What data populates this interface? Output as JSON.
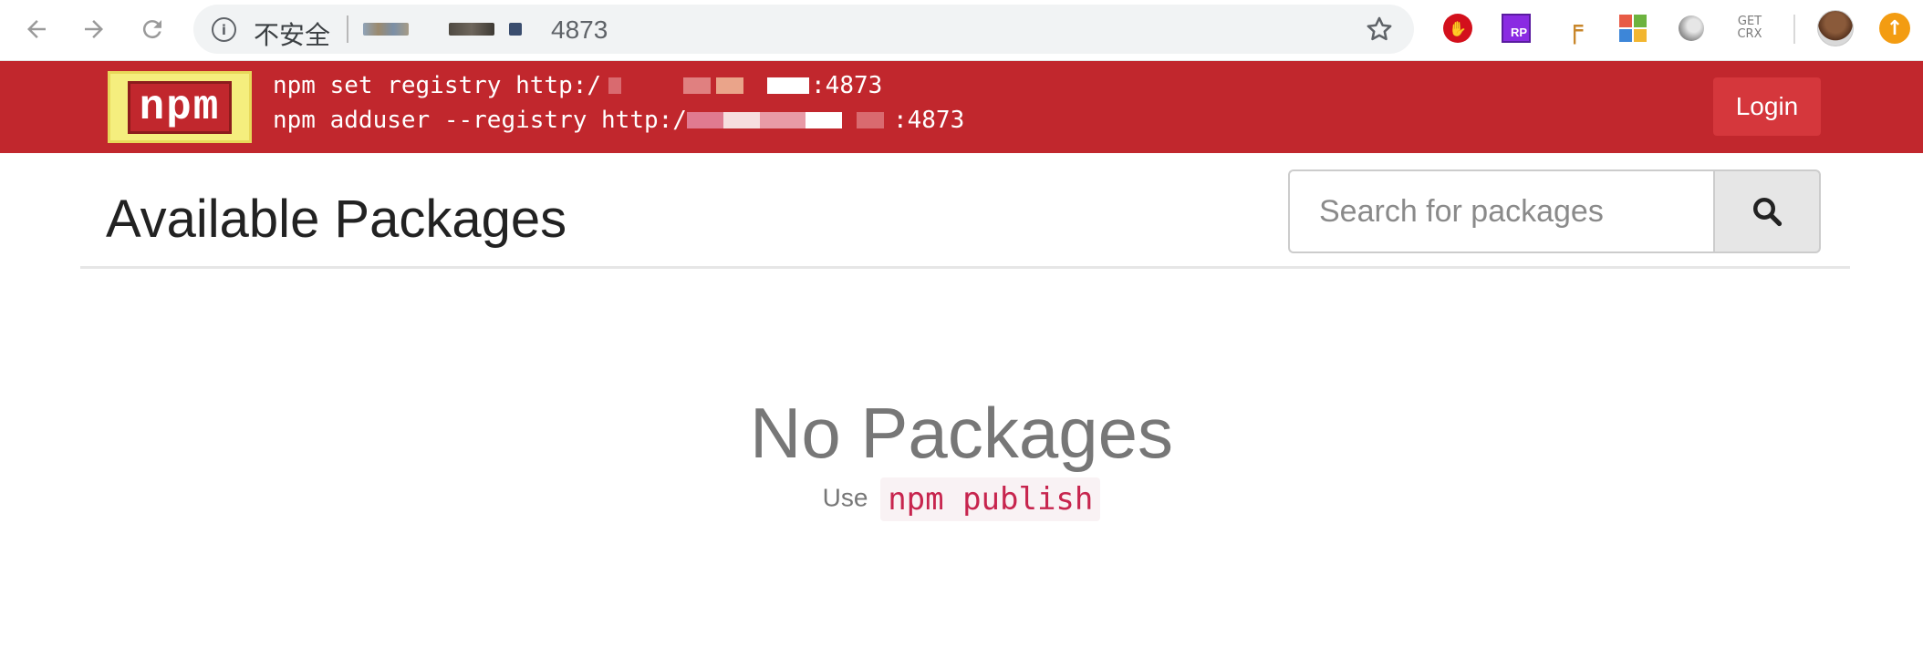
{
  "browser": {
    "security_label": "不安全",
    "address_port": "4873",
    "extensions": {
      "crx_label": "GET\nCRX",
      "rp_label": "RP"
    }
  },
  "header": {
    "logo_text": "npm",
    "cmd_set_prefix": "npm set registry http:/",
    "cmd_set_suffix": ":4873",
    "cmd_adduser_prefix": "npm adduser --registry http:/",
    "cmd_adduser_suffix": ":4873",
    "login_label": "Login",
    "header_color": "#c1272d"
  },
  "main": {
    "title": "Available Packages",
    "search_placeholder": "Search for packages",
    "empty_title": "No Packages",
    "empty_hint_prefix": "Use",
    "empty_hint_command": "npm publish"
  }
}
